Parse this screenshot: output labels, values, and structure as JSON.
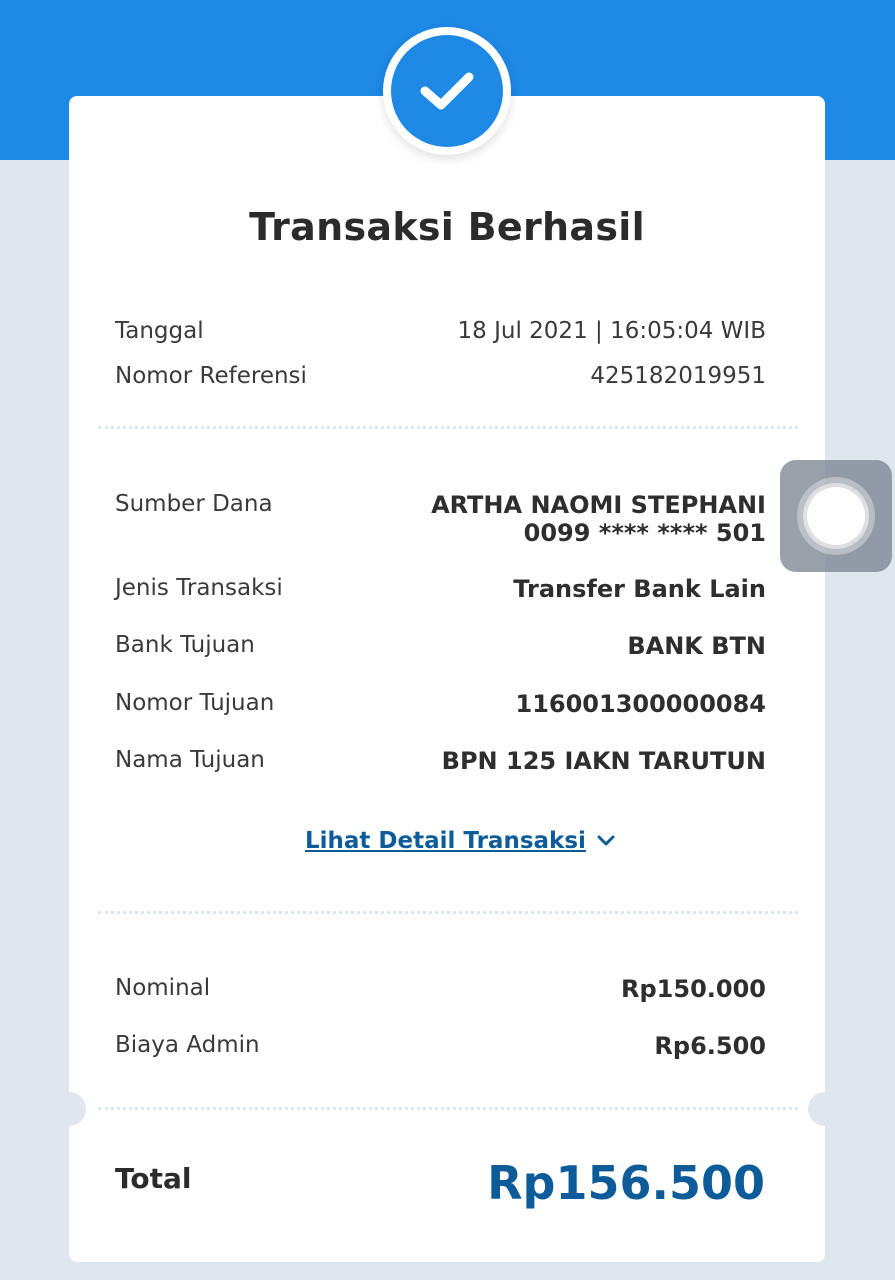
{
  "header": {
    "title": "Transaksi Berhasil",
    "status_icon": "check-icon"
  },
  "info": [
    {
      "label": "Tanggal",
      "value": "18 Jul 2021 | 16:05:04 WIB"
    },
    {
      "label": "Nomor Referensi",
      "value": "425182019951"
    }
  ],
  "details": {
    "source_label": "Sumber Dana",
    "source_name": "ARTHA NAOMI STEPHANI",
    "source_account": "0099 **** **** 501",
    "rows": [
      {
        "label": "Jenis Transaksi",
        "value": "Transfer Bank Lain"
      },
      {
        "label": "Bank Tujuan",
        "value": "BANK BTN"
      },
      {
        "label": "Nomor Tujuan",
        "value": "116001300000084"
      },
      {
        "label": "Nama Tujuan",
        "value": "BPN 125 IAKN TARUTUN"
      }
    ],
    "detail_link": "Lihat Detail Transaksi"
  },
  "amounts": [
    {
      "label": "Nominal",
      "value": "Rp150.000"
    },
    {
      "label": "Biaya Admin",
      "value": "Rp6.500"
    }
  ],
  "total": {
    "label": "Total",
    "value": "Rp156.500"
  },
  "colors": {
    "brand": "#1e88e5",
    "accent_text": "#0d5c99",
    "background": "#dfe6ee"
  }
}
